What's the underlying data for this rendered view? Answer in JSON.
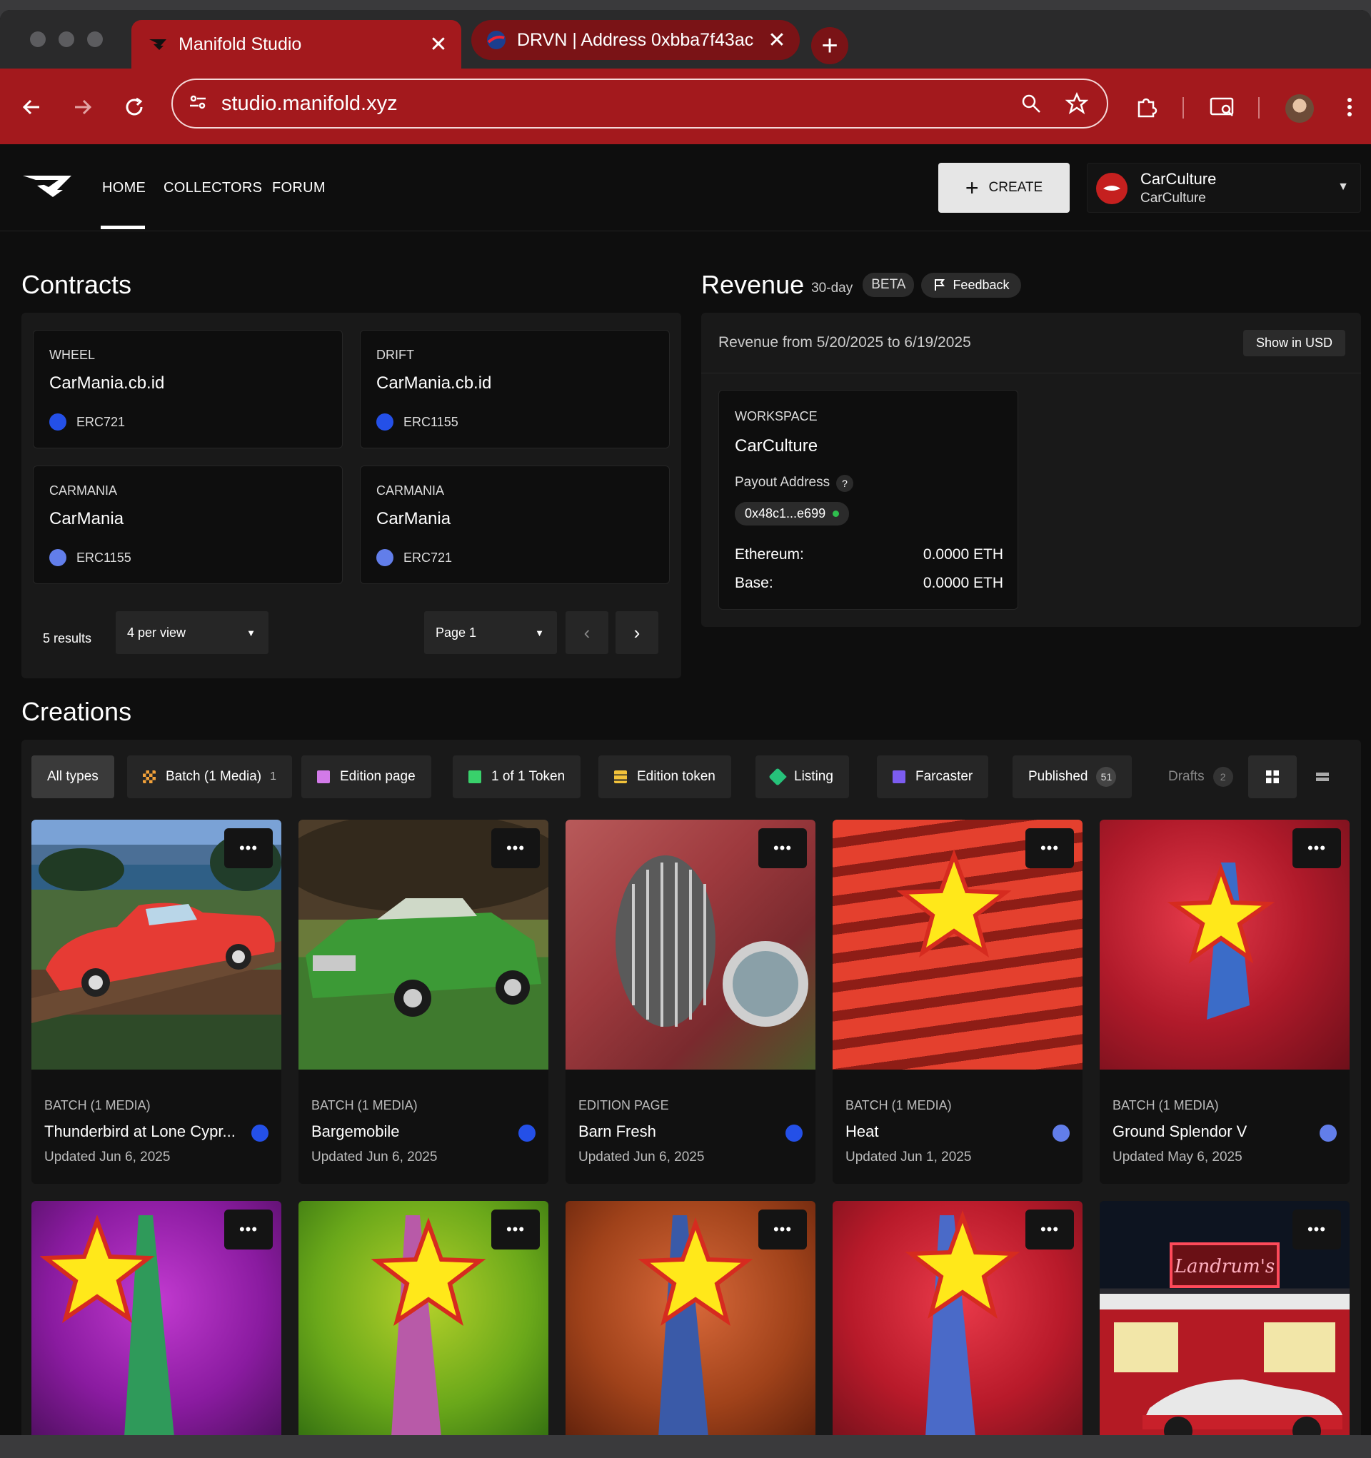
{
  "browser": {
    "tabs": [
      {
        "title": "Manifold Studio",
        "close": "✕"
      },
      {
        "title": "DRVN | Address 0xbba7f43ac",
        "close": "✕"
      }
    ],
    "new_tab": "+",
    "url": "studio.manifold.xyz"
  },
  "header": {
    "nav": [
      "HOME",
      "COLLECTORS",
      "FORUM"
    ],
    "create_label": "CREATE",
    "account_name": "CarCulture",
    "account_sub": "CarCulture"
  },
  "contracts": {
    "title": "Contracts",
    "items": [
      {
        "type": "WHEEL",
        "name": "CarMania.cb.id",
        "standard": "ERC721",
        "chain": "base"
      },
      {
        "type": "DRIFT",
        "name": "CarMania.cb.id",
        "standard": "ERC1155",
        "chain": "base"
      },
      {
        "type": "CARMANIA",
        "name": "CarMania",
        "standard": "ERC1155",
        "chain": "ethereum"
      },
      {
        "type": "CARMANIA",
        "name": "CarMania",
        "standard": "ERC721",
        "chain": "ethereum"
      }
    ],
    "results": "5 results",
    "per_view": "4 per view",
    "page": "Page 1"
  },
  "revenue": {
    "title": "Revenue",
    "period": "30-day",
    "beta": "BETA",
    "feedback": "Feedback",
    "range": "Revenue from 5/20/2025 to 6/19/2025",
    "show_usd": "Show in USD",
    "workspace_label": "WORKSPACE",
    "workspace_name": "CarCulture",
    "payout_label": "Payout Address",
    "payout_help": "?",
    "payout_address": "0x48c1...e699",
    "balances": [
      {
        "label": "Ethereum:",
        "value": "0.0000 ETH"
      },
      {
        "label": "Base:",
        "value": "0.0000 ETH"
      }
    ]
  },
  "creations": {
    "title": "Creations",
    "filters": [
      {
        "label": "All types"
      },
      {
        "label": "Batch (1 Media)",
        "count": "1"
      },
      {
        "label": "Edition page"
      },
      {
        "label": "1 of 1 Token"
      },
      {
        "label": "Edition token"
      },
      {
        "label": "Listing"
      },
      {
        "label": "Farcaster"
      },
      {
        "label": "Published",
        "count": "51"
      },
      {
        "label": "Drafts",
        "count": "2"
      }
    ],
    "more_label": "•••",
    "cards": [
      {
        "type": "BATCH (1 MEDIA)",
        "title": "Thunderbird at Lone Cypr...",
        "updated": "Updated Jun 6, 2025",
        "chain": "base"
      },
      {
        "type": "BATCH (1 MEDIA)",
        "title": "Bargemobile",
        "updated": "Updated Jun 6, 2025",
        "chain": "base"
      },
      {
        "type": "EDITION PAGE",
        "title": "Barn Fresh",
        "updated": "Updated Jun 6, 2025",
        "chain": "base"
      },
      {
        "type": "BATCH (1 MEDIA)",
        "title": "Heat",
        "updated": "Updated Jun 1, 2025",
        "chain": "ethereum"
      },
      {
        "type": "BATCH (1 MEDIA)",
        "title": "Ground Splendor V",
        "updated": "Updated May 6, 2025",
        "chain": "ethereum"
      }
    ],
    "sign_text": "Landrum's"
  }
}
